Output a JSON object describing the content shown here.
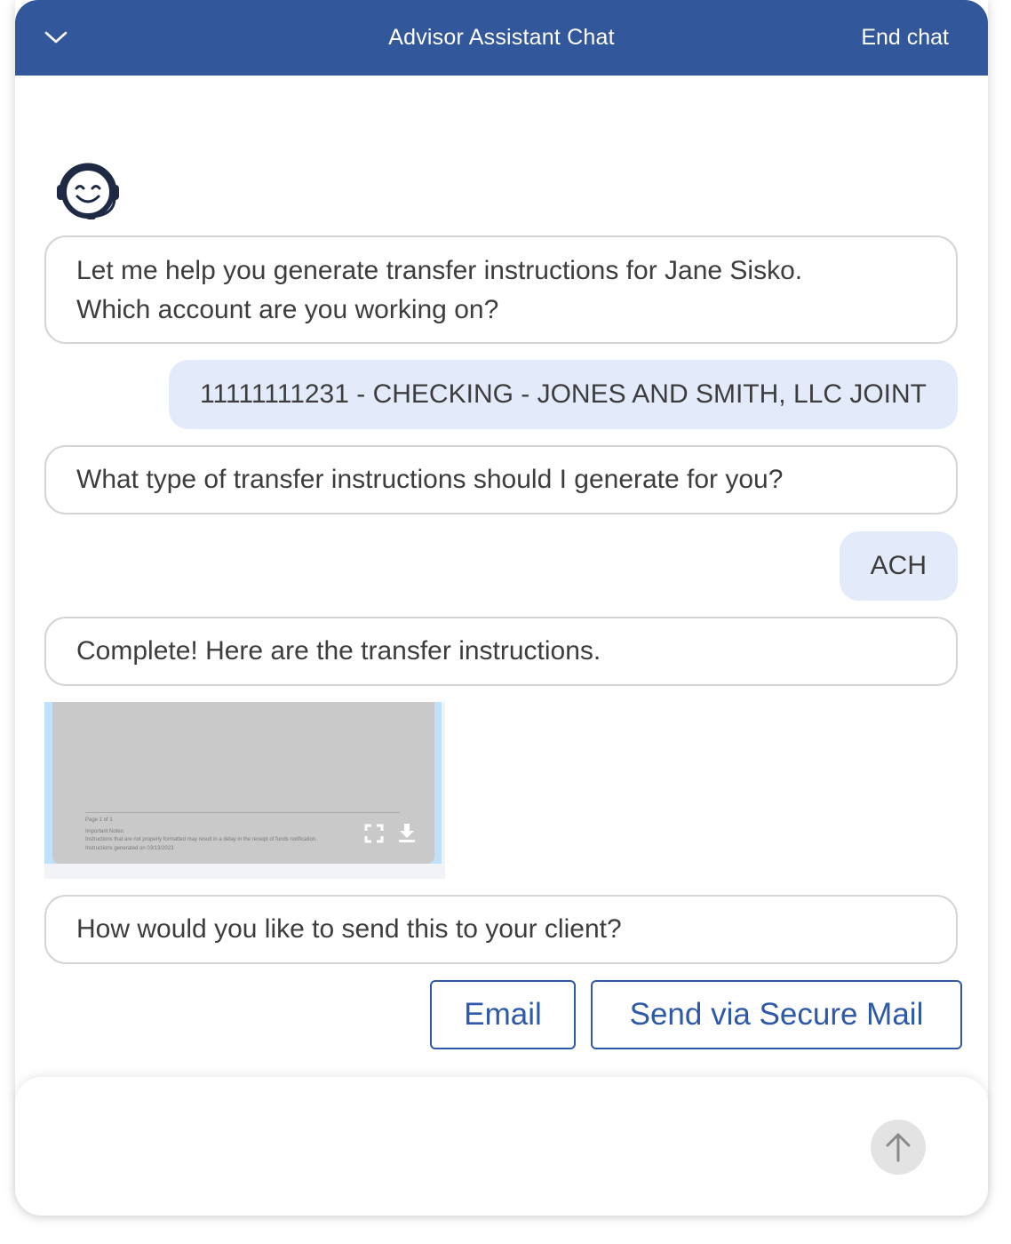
{
  "header": {
    "title": "Advisor Assistant Chat",
    "end_chat_label": "End chat",
    "collapse_icon": "chevron-down-icon",
    "background_color": "#33579b"
  },
  "assistant": {
    "avatar_icon": "headset-smiley-icon"
  },
  "messages": [
    {
      "from": "assistant",
      "lines": [
        "Let me help you generate transfer instructions for Jane Sisko.",
        "Which account are you working on?"
      ]
    },
    {
      "from": "user",
      "text": "11111111231 - CHECKING - JONES AND SMITH, LLC JOINT"
    },
    {
      "from": "assistant",
      "lines": [
        "What type of transfer instructions should I generate for you?"
      ]
    },
    {
      "from": "user",
      "text": "ACH"
    },
    {
      "from": "assistant",
      "lines": [
        "Complete! Here are the transfer instructions."
      ]
    },
    {
      "from": "assistant",
      "lines": [
        "How would you like to send this to your client?"
      ]
    }
  ],
  "document_preview": {
    "page_label": "Page 1 of  1",
    "notes_heading": "Important Notes:",
    "note_text": "Instructions that are not properly formatted may result in a delay in the receipt of funds notification.",
    "generated_text": "Instructions generated on 03/13/2023",
    "expand_icon": "expand-icon",
    "download_icon": "download-icon"
  },
  "options": {
    "email_label": "Email",
    "secure_mail_label": "Send via Secure Mail",
    "accent_color": "#2e59a8"
  },
  "composer": {
    "input_value": "",
    "send_icon": "arrow-up-icon"
  },
  "colors": {
    "user_bubble": "#e3ebfb",
    "bot_bubble_border": "#d4d4d4"
  }
}
